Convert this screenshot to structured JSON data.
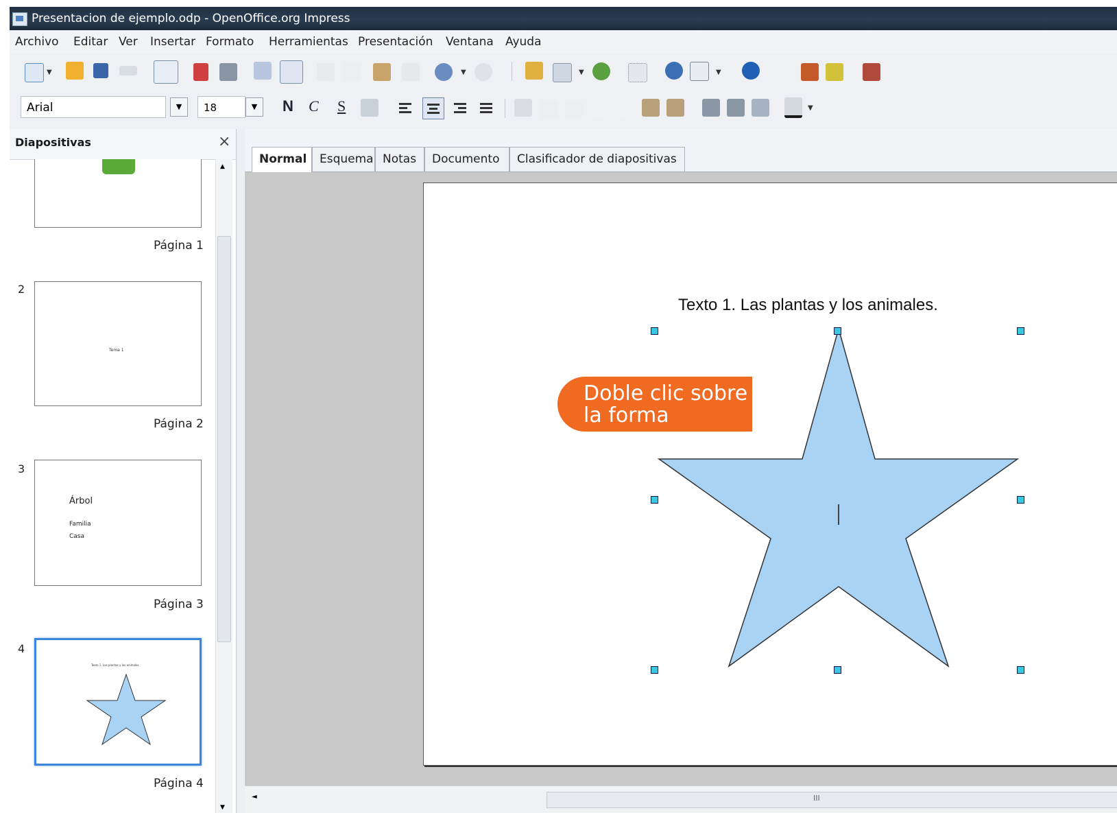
{
  "window": {
    "title": "Presentacion de ejemplo.odp - OpenOffice.org Impress"
  },
  "menu": [
    "Archivo",
    "Editar",
    "Ver",
    "Insertar",
    "Formato",
    "Herramientas",
    "Presentación",
    "Ventana",
    "Ayuda"
  ],
  "format_toolbar": {
    "font_name": "Arial",
    "font_size": "18",
    "bold_label": "N",
    "italic_label": "C",
    "shadow_label": "S"
  },
  "toolbar_icons": [
    "new-document",
    "open-folder",
    "save",
    "email",
    "edit-mode",
    "export-pdf",
    "print",
    "spellcheck",
    "autospellcheck",
    "cut",
    "copy",
    "paste",
    "clone-format",
    "undo",
    "redo",
    "chart",
    "table",
    "insert-graphic",
    "grid",
    "navigator",
    "zoom",
    "help",
    "gallery",
    "presentation"
  ],
  "slide_pane": {
    "title": "Diapositivas",
    "close": "×",
    "slides": [
      {
        "num": "",
        "label": "Página 1"
      },
      {
        "num": "2",
        "label": "Página 2",
        "content": "Tema 1"
      },
      {
        "num": "3",
        "label": "Página 3",
        "content": [
          "Árbol",
          "Familia",
          "Casa"
        ]
      },
      {
        "num": "4",
        "label": "Página 4",
        "content": "Texto 1. Las plantas y los animales."
      }
    ]
  },
  "view_tabs": [
    "Normal",
    "Esquema",
    "Notas",
    "Documento",
    "Clasificador de diapositivas"
  ],
  "active_tab": "Normal",
  "slide": {
    "text": "Texto 1. Las plantas y los animales.",
    "shape": "star",
    "shape_fill": "#a9d3f5",
    "cursor": "I"
  },
  "callout": {
    "line1": "Doble clic sobre",
    "line2": "la forma",
    "color": "#f06a22"
  },
  "scrollbar": {
    "grip": "III"
  }
}
